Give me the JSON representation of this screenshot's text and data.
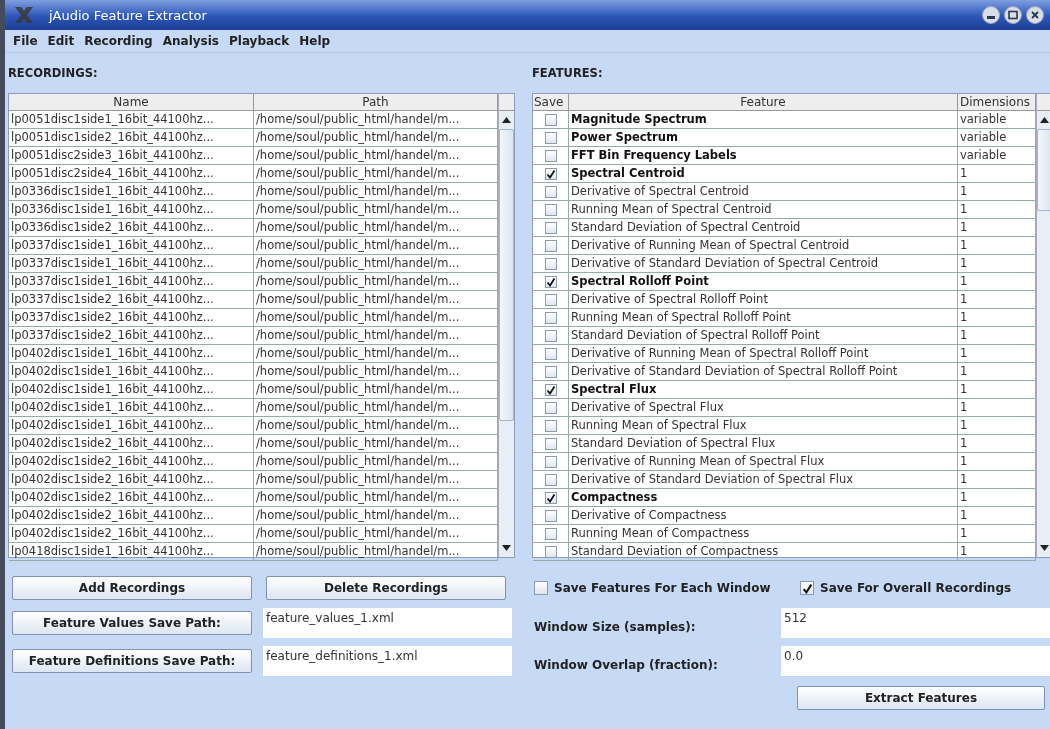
{
  "window": {
    "title": "jAudio Feature Extractor"
  },
  "menu": [
    "File",
    "Edit",
    "Recording",
    "Analysis",
    "Playback",
    "Help"
  ],
  "recordings": {
    "label": "RECORDINGS:",
    "columns": [
      "Name",
      "Path"
    ],
    "rows": [
      {
        "name": "lp0051disc1side1_16bit_44100hz...",
        "path": "/home/soul/public_html/handel/m..."
      },
      {
        "name": "lp0051disc1side2_16bit_44100hz...",
        "path": "/home/soul/public_html/handel/m..."
      },
      {
        "name": "lp0051disc2side3_16bit_44100hz...",
        "path": "/home/soul/public_html/handel/m..."
      },
      {
        "name": "lp0051disc2side4_16bit_44100hz...",
        "path": "/home/soul/public_html/handel/m..."
      },
      {
        "name": "lp0336disc1side1_16bit_44100hz...",
        "path": "/home/soul/public_html/handel/m..."
      },
      {
        "name": "lp0336disc1side1_16bit_44100hz...",
        "path": "/home/soul/public_html/handel/m..."
      },
      {
        "name": "lp0336disc1side2_16bit_44100hz...",
        "path": "/home/soul/public_html/handel/m..."
      },
      {
        "name": "lp0337disc1side1_16bit_44100hz...",
        "path": "/home/soul/public_html/handel/m..."
      },
      {
        "name": "lp0337disc1side1_16bit_44100hz...",
        "path": "/home/soul/public_html/handel/m..."
      },
      {
        "name": "lp0337disc1side1_16bit_44100hz...",
        "path": "/home/soul/public_html/handel/m..."
      },
      {
        "name": "lp0337disc1side2_16bit_44100hz...",
        "path": "/home/soul/public_html/handel/m..."
      },
      {
        "name": "lp0337disc1side2_16bit_44100hz...",
        "path": "/home/soul/public_html/handel/m..."
      },
      {
        "name": "lp0337disc1side2_16bit_44100hz...",
        "path": "/home/soul/public_html/handel/m..."
      },
      {
        "name": "lp0402disc1side1_16bit_44100hz...",
        "path": "/home/soul/public_html/handel/m..."
      },
      {
        "name": "lp0402disc1side1_16bit_44100hz...",
        "path": "/home/soul/public_html/handel/m..."
      },
      {
        "name": "lp0402disc1side1_16bit_44100hz...",
        "path": "/home/soul/public_html/handel/m..."
      },
      {
        "name": "lp0402disc1side1_16bit_44100hz...",
        "path": "/home/soul/public_html/handel/m..."
      },
      {
        "name": "lp0402disc1side1_16bit_44100hz...",
        "path": "/home/soul/public_html/handel/m..."
      },
      {
        "name": "lp0402disc1side2_16bit_44100hz...",
        "path": "/home/soul/public_html/handel/m..."
      },
      {
        "name": "lp0402disc1side2_16bit_44100hz...",
        "path": "/home/soul/public_html/handel/m..."
      },
      {
        "name": "lp0402disc1side2_16bit_44100hz...",
        "path": "/home/soul/public_html/handel/m..."
      },
      {
        "name": "lp0402disc1side2_16bit_44100hz...",
        "path": "/home/soul/public_html/handel/m..."
      },
      {
        "name": "lp0402disc1side2_16bit_44100hz...",
        "path": "/home/soul/public_html/handel/m..."
      },
      {
        "name": "lp0402disc1side2_16bit_44100hz...",
        "path": "/home/soul/public_html/handel/m..."
      },
      {
        "name": "lp0418disc1side1_16bit_44100hz...",
        "path": "/home/soul/public_html/handel/m..."
      }
    ]
  },
  "features": {
    "label": "FEATURES:",
    "columns": [
      "Save",
      "Feature",
      "Dimensions"
    ],
    "rows": [
      {
        "kind": "base",
        "checked": false,
        "feature": "Magnitude Spectrum",
        "dimensions": "variable"
      },
      {
        "kind": "base",
        "checked": false,
        "feature": "Power Spectrum",
        "dimensions": "variable"
      },
      {
        "kind": "base",
        "checked": false,
        "feature": "FFT Bin Frequency Labels",
        "dimensions": "variable"
      },
      {
        "kind": "base",
        "checked": true,
        "feature": "Spectral Centroid",
        "dimensions": "1"
      },
      {
        "kind": "derived",
        "checked": false,
        "feature": "Derivative of Spectral Centroid",
        "dimensions": "1"
      },
      {
        "kind": "derived",
        "checked": false,
        "feature": "Running Mean of Spectral Centroid",
        "dimensions": "1"
      },
      {
        "kind": "derived",
        "checked": false,
        "feature": "Standard Deviation of Spectral Centroid",
        "dimensions": "1"
      },
      {
        "kind": "derived",
        "checked": false,
        "feature": "Derivative of Running Mean of Spectral Centroid",
        "dimensions": "1"
      },
      {
        "kind": "derived",
        "checked": false,
        "feature": "Derivative of Standard Deviation of Spectral Centroid",
        "dimensions": "1"
      },
      {
        "kind": "base",
        "checked": true,
        "feature": "Spectral Rolloff Point",
        "dimensions": "1"
      },
      {
        "kind": "derived",
        "checked": false,
        "feature": "Derivative of Spectral Rolloff Point",
        "dimensions": "1"
      },
      {
        "kind": "derived",
        "checked": false,
        "feature": "Running Mean of Spectral Rolloff Point",
        "dimensions": "1"
      },
      {
        "kind": "derived",
        "checked": false,
        "feature": "Standard Deviation of Spectral Rolloff Point",
        "dimensions": "1"
      },
      {
        "kind": "derived",
        "checked": false,
        "feature": "Derivative of Running Mean of Spectral Rolloff Point",
        "dimensions": "1"
      },
      {
        "kind": "derived",
        "checked": false,
        "feature": "Derivative of Standard Deviation of Spectral Rolloff Point",
        "dimensions": "1"
      },
      {
        "kind": "base",
        "checked": true,
        "feature": "Spectral Flux",
        "dimensions": "1"
      },
      {
        "kind": "derived",
        "checked": false,
        "feature": "Derivative of Spectral Flux",
        "dimensions": "1"
      },
      {
        "kind": "derived",
        "checked": false,
        "feature": "Running Mean of Spectral Flux",
        "dimensions": "1"
      },
      {
        "kind": "derived",
        "checked": false,
        "feature": "Standard Deviation of Spectral Flux",
        "dimensions": "1"
      },
      {
        "kind": "derived",
        "checked": false,
        "feature": "Derivative of Running Mean of Spectral Flux",
        "dimensions": "1"
      },
      {
        "kind": "derived",
        "checked": false,
        "feature": "Derivative of Standard Deviation of Spectral Flux",
        "dimensions": "1"
      },
      {
        "kind": "base",
        "checked": true,
        "feature": "Compactness",
        "dimensions": "1"
      },
      {
        "kind": "derived",
        "checked": false,
        "feature": "Derivative of Compactness",
        "dimensions": "1"
      },
      {
        "kind": "derived",
        "checked": false,
        "feature": "Running Mean of Compactness",
        "dimensions": "1"
      },
      {
        "kind": "derived",
        "checked": false,
        "feature": "Standard Deviation of Compactness",
        "dimensions": "1"
      }
    ]
  },
  "add_button": "Add Recordings",
  "delete_button": "Delete Recordings",
  "options": [
    {
      "label": "Save Features For Each Window",
      "checked": false
    },
    {
      "label": "Save For Overall Recordings",
      "checked": true
    }
  ],
  "save_paths": [
    {
      "button": "Feature Values Save Path:",
      "value": "feature_values_1.xml"
    },
    {
      "button": "Feature Definitions Save Path:",
      "value": "feature_definitions_1.xml"
    }
  ],
  "settings": [
    {
      "label": "Window Size (samples):",
      "value": "512"
    },
    {
      "label": "Window Overlap (fraction):",
      "value": "0.0"
    }
  ],
  "extract_button": "Extract Features"
}
